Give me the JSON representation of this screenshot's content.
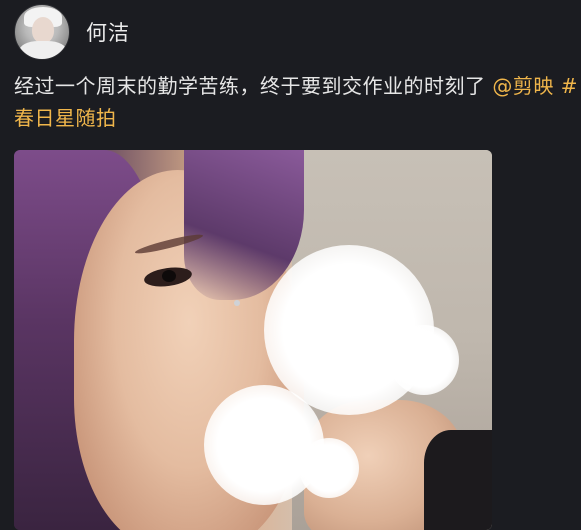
{
  "post": {
    "username": "何洁",
    "text_main": "经过一个周末的勤学苦练，终于要到交作业的时刻了 ",
    "mention": "@剪映",
    "tag": " #春日星随拍"
  },
  "colors": {
    "background": "#1b1c21",
    "text": "#e6e6e6",
    "link": "#f0b64b"
  },
  "icons": {
    "avatar": "user-avatar"
  }
}
